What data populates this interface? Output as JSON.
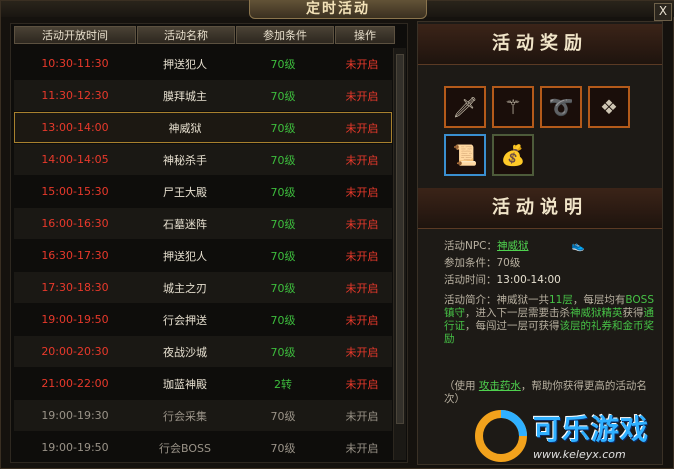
{
  "window": {
    "title": "定时活动",
    "close_glyph": "X"
  },
  "columns": [
    "活动开放时间",
    "活动名称",
    "参加条件",
    "操作"
  ],
  "rows": [
    {
      "time": "10:30-11:30",
      "name": "押送犯人",
      "cond": "70级",
      "op": "未开启",
      "status": "normal"
    },
    {
      "time": "11:30-12:30",
      "name": "膜拜城主",
      "cond": "70级",
      "op": "未开启",
      "status": "normal"
    },
    {
      "time": "13:00-14:00",
      "name": "神威狱",
      "cond": "70级",
      "op": "未开启",
      "status": "normal"
    },
    {
      "time": "14:00-14:05",
      "name": "神秘杀手",
      "cond": "70级",
      "op": "未开启",
      "status": "normal"
    },
    {
      "time": "15:00-15:30",
      "name": "尸王大殿",
      "cond": "70级",
      "op": "未开启",
      "status": "normal"
    },
    {
      "time": "16:00-16:30",
      "name": "石墓迷阵",
      "cond": "70级",
      "op": "未开启",
      "status": "normal"
    },
    {
      "time": "16:30-17:30",
      "name": "押送犯人",
      "cond": "70级",
      "op": "未开启",
      "status": "normal"
    },
    {
      "time": "17:30-18:30",
      "name": "城主之刃",
      "cond": "70级",
      "op": "未开启",
      "status": "normal"
    },
    {
      "time": "19:00-19:50",
      "name": "行会押送",
      "cond": "70级",
      "op": "未开启",
      "status": "normal"
    },
    {
      "time": "20:00-20:30",
      "name": "夜战沙城",
      "cond": "70级",
      "op": "未开启",
      "status": "normal"
    },
    {
      "time": "21:00-22:00",
      "name": "珈蓝神殿",
      "cond": "2转",
      "op": "未开启",
      "status": "normal"
    },
    {
      "time": "19:00-19:30",
      "name": "行会采集",
      "cond": "70级",
      "op": "未开启",
      "status": "guild"
    },
    {
      "time": "19:00-19:50",
      "name": "行会BOSS",
      "cond": "70级",
      "op": "未开启",
      "status": "guild"
    }
  ],
  "selected_row": 2,
  "rewards": {
    "heading": "活动奖励",
    "items": [
      "sword-icon",
      "staff-icon",
      "whip-icon",
      "jade-icon",
      "scroll-icon",
      "gold-coins-icon"
    ]
  },
  "info": {
    "heading": "活动说明",
    "npc_label": "活动NPC：",
    "npc_name": "神威狱",
    "cond_label": "参加条件：",
    "cond_value": "70级",
    "time_label": "活动时间：",
    "time_value": "13:00-14:00",
    "intro_label": "活动简介：",
    "intro_1": "神威狱一共",
    "intro_floors": "11层",
    "intro_2": "，每层均有",
    "intro_boss": "BOSS镇守",
    "intro_3": "，进入下一层需要击杀",
    "intro_elite": "神威狱精英",
    "intro_4": "获得",
    "intro_pass": "通行证",
    "intro_5": "，每闯过一层可获得",
    "intro_reward": "该层的礼券和金币奖励",
    "tip_1": "（使用 ",
    "tip_link": "攻击药水",
    "tip_2": "，帮助你获得更高的活动名次）"
  },
  "watermark": {
    "name": "可乐游戏",
    "url": "www.keleyx.com"
  },
  "colors": {
    "time_active": "#e8392b",
    "time_guild": "#9a9388",
    "cond": "#3dbd3d",
    "op": "#e8392b",
    "guild_text": "#9a9388"
  }
}
